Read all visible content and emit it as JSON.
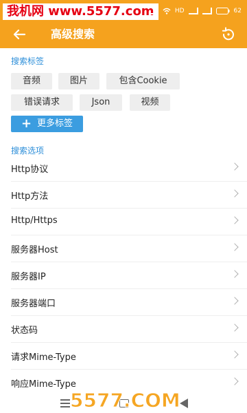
{
  "watermark_top": "我机网 www.5577.com",
  "status_bar": {
    "icons": [
      "signal-icon",
      "wifi-icon",
      "hd-icon",
      "signal-icon",
      "signal-icon",
      "battery-icon"
    ],
    "hd_label": "HD",
    "battery_label": "62"
  },
  "app_bar": {
    "title": "高级搜索",
    "back_icon": "arrow-left-icon",
    "reset_icon": "reset-icon",
    "accent_color": "#f5a21e"
  },
  "search_tags": {
    "section_title": "搜索标签",
    "tags": [
      "音频",
      "图片",
      "包含Cookie",
      "错误请求",
      "Json",
      "视频"
    ],
    "more_button_label": "更多标签",
    "more_button_icon": "plus-icon",
    "more_button_color": "#3b9de0"
  },
  "search_options": {
    "section_title": "搜索选项",
    "items": [
      "Http协议",
      "Http方法",
      "Http/Https",
      "服务器Host",
      "服务器IP",
      "服务器端口",
      "状态码",
      "请求Mime-Type",
      "响应Mime-Type"
    ],
    "item_icon": "chevron-right-icon"
  },
  "nav_bar": {
    "icons": [
      "menu-icon",
      "home-icon",
      "back-icon"
    ]
  },
  "watermark_bottom": "5577.COM"
}
